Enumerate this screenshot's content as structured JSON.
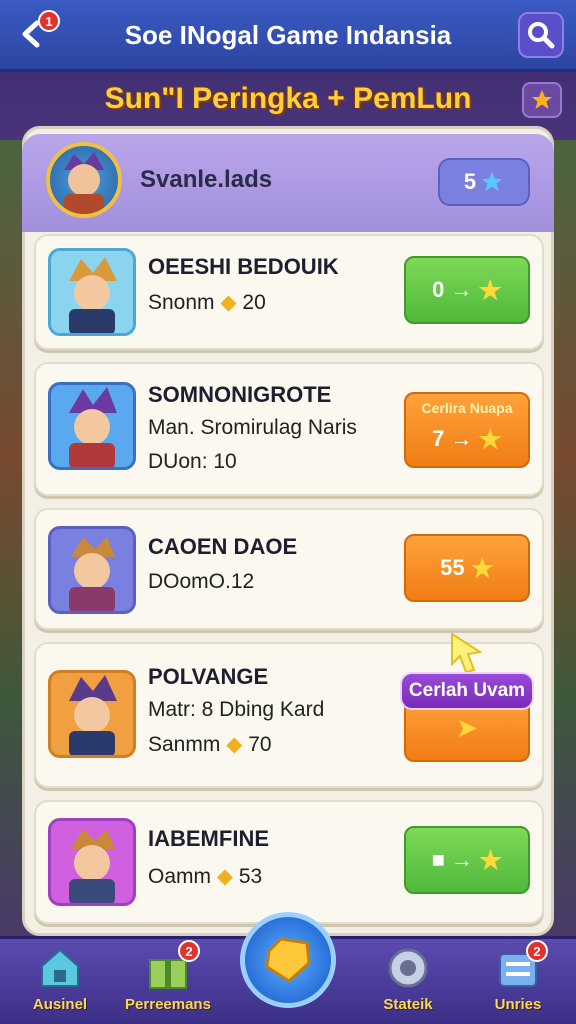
{
  "header": {
    "title": "Soe INogal Game Indansia",
    "back_badge": "1"
  },
  "page": {
    "title": "Sun\"I Peringka + PemLun"
  },
  "current_player": {
    "name": "Svanle.lads",
    "score": "5"
  },
  "players": [
    {
      "name": "OEESHI BEDOUIK",
      "line1": "Snonm",
      "line1_value": "20",
      "action": "0 →",
      "action_color": "green"
    },
    {
      "name": "SOMNONIGROTE",
      "line1": "Man. Sromirulag Naris",
      "line2": "DUon: 10",
      "action_sub": "Cerlira Nuapa",
      "action": "7 →",
      "action_color": "orange"
    },
    {
      "name": "CAOEN DAOE",
      "line1": "DOomO.12",
      "action": "55",
      "action_color": "orange"
    },
    {
      "name": "POLVANGE",
      "line1": "Matr: 8 Dbing Kard",
      "line2": "Sanmm",
      "line2_value": "70",
      "action_color": "orange"
    },
    {
      "name": "IABEMFINE",
      "line1": "Oamm",
      "line1_value": "53",
      "action": "■ →",
      "action_color": "green"
    }
  ],
  "tooltip": {
    "label": "Cerlah Uvam"
  },
  "nav": {
    "items": [
      {
        "label": "Ausinel",
        "icon": "house-icon"
      },
      {
        "label": "Perreemans",
        "icon": "gift-icon",
        "badge": "2"
      },
      {
        "label": "Stateik",
        "icon": "gear-icon"
      },
      {
        "label": "Unries",
        "icon": "list-icon",
        "badge": "2"
      }
    ],
    "center_icon": "gem-icon"
  },
  "colors": {
    "topbar": "#3a5bc4",
    "accent_gold": "#ffcf3a",
    "green_button": "#4fb83a",
    "orange_button": "#f07d14",
    "panel_header": "#a28fdc"
  }
}
